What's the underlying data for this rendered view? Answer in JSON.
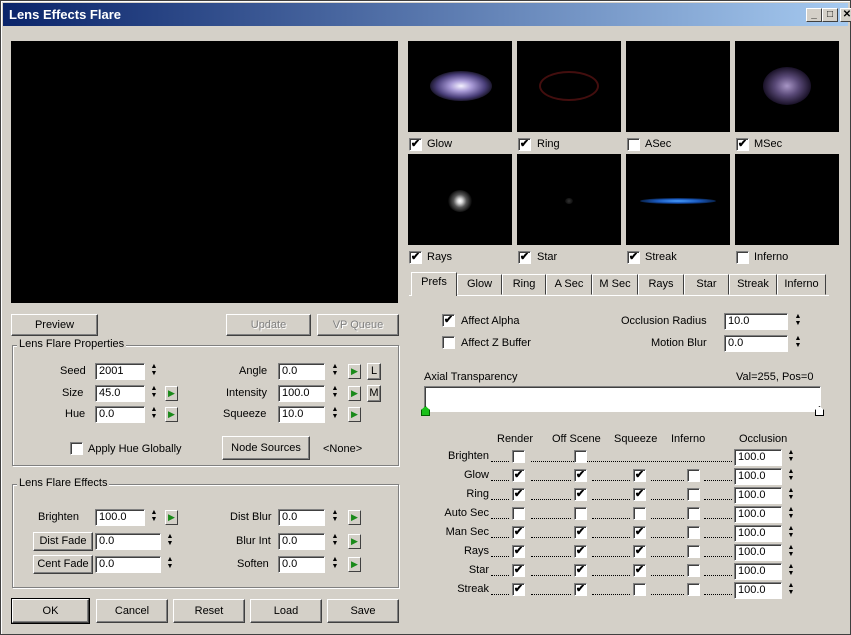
{
  "window": {
    "title": "Lens Effects Flare",
    "minimize_glyph": "_",
    "maximize_glyph": "□",
    "close_glyph": "✕"
  },
  "thumbnails": [
    {
      "label": "Glow",
      "checked": true
    },
    {
      "label": "Ring",
      "checked": true
    },
    {
      "label": "ASec",
      "checked": false
    },
    {
      "label": "MSec",
      "checked": true
    },
    {
      "label": "Rays",
      "checked": true
    },
    {
      "label": "Star",
      "checked": true
    },
    {
      "label": "Streak",
      "checked": true
    },
    {
      "label": "Inferno",
      "checked": false
    }
  ],
  "preview_buttons": {
    "preview": "Preview",
    "update": "Update",
    "vp_queue": "VP Queue"
  },
  "properties": {
    "title": "Lens Flare Properties",
    "seed_label": "Seed",
    "seed": "2001",
    "size_label": "Size",
    "size": "45.0",
    "hue_label": "Hue",
    "hue": "0.0",
    "angle_label": "Angle",
    "angle": "0.0",
    "intensity_label": "Intensity",
    "intensity": "100.0",
    "squeeze_label": "Squeeze",
    "squeeze": "10.0",
    "l_button": "L",
    "m_button": "M",
    "apply_hue_label": "Apply Hue Globally",
    "node_sources": "Node Sources",
    "none_label": "<None>"
  },
  "effects": {
    "title": "Lens Flare Effects",
    "brighten_label": "Brighten",
    "brighten": "100.0",
    "dist_fade_label": "Dist Fade",
    "dist_fade": "0.0",
    "cent_fade_label": "Cent Fade",
    "cent_fade": "0.0",
    "dist_blur_label": "Dist Blur",
    "dist_blur": "0.0",
    "blur_int_label": "Blur Int",
    "blur_int": "0.0",
    "soften_label": "Soften",
    "soften": "0.0"
  },
  "bottom_buttons": {
    "ok": "OK",
    "cancel": "Cancel",
    "reset": "Reset",
    "load": "Load",
    "save": "Save"
  },
  "tabs": [
    "Prefs",
    "Glow",
    "Ring",
    "A Sec",
    "M Sec",
    "Rays",
    "Star",
    "Streak",
    "Inferno"
  ],
  "prefs": {
    "affect_alpha_label": "Affect Alpha",
    "affect_alpha": true,
    "affect_z_label": "Affect Z Buffer",
    "affect_z": false,
    "occlusion_radius_label": "Occlusion Radius",
    "occlusion_radius": "10.0",
    "motion_blur_label": "Motion Blur",
    "motion_blur": "0.0",
    "axial_label": "Axial Transparency",
    "axial_status": "Val=255, Pos=0"
  },
  "matrix": {
    "headers": {
      "render": "Render",
      "off_scene": "Off Scene",
      "squeeze": "Squeeze",
      "inferno": "Inferno",
      "occlusion": "Occlusion"
    },
    "rows": [
      {
        "label": "Brighten",
        "render": false,
        "off_scene": false,
        "squeeze": null,
        "inferno": null,
        "occlusion": "100.0"
      },
      {
        "label": "Glow",
        "render": true,
        "off_scene": true,
        "squeeze": true,
        "inferno": false,
        "occlusion": "100.0"
      },
      {
        "label": "Ring",
        "render": true,
        "off_scene": true,
        "squeeze": true,
        "inferno": false,
        "occlusion": "100.0"
      },
      {
        "label": "Auto Sec",
        "render": false,
        "off_scene": false,
        "squeeze": false,
        "inferno": false,
        "occlusion": "100.0"
      },
      {
        "label": "Man Sec",
        "render": true,
        "off_scene": true,
        "squeeze": true,
        "inferno": false,
        "occlusion": "100.0"
      },
      {
        "label": "Rays",
        "render": true,
        "off_scene": true,
        "squeeze": true,
        "inferno": false,
        "occlusion": "100.0"
      },
      {
        "label": "Star",
        "render": true,
        "off_scene": true,
        "squeeze": true,
        "inferno": false,
        "occlusion": "100.0"
      },
      {
        "label": "Streak",
        "render": true,
        "off_scene": true,
        "squeeze": false,
        "inferno": false,
        "occlusion": "100.0"
      }
    ]
  },
  "colors": {
    "title_start": "#0a246a",
    "title_end": "#a6caf0",
    "face": "#d4d0c8",
    "key_green": "#1a8a1a"
  }
}
